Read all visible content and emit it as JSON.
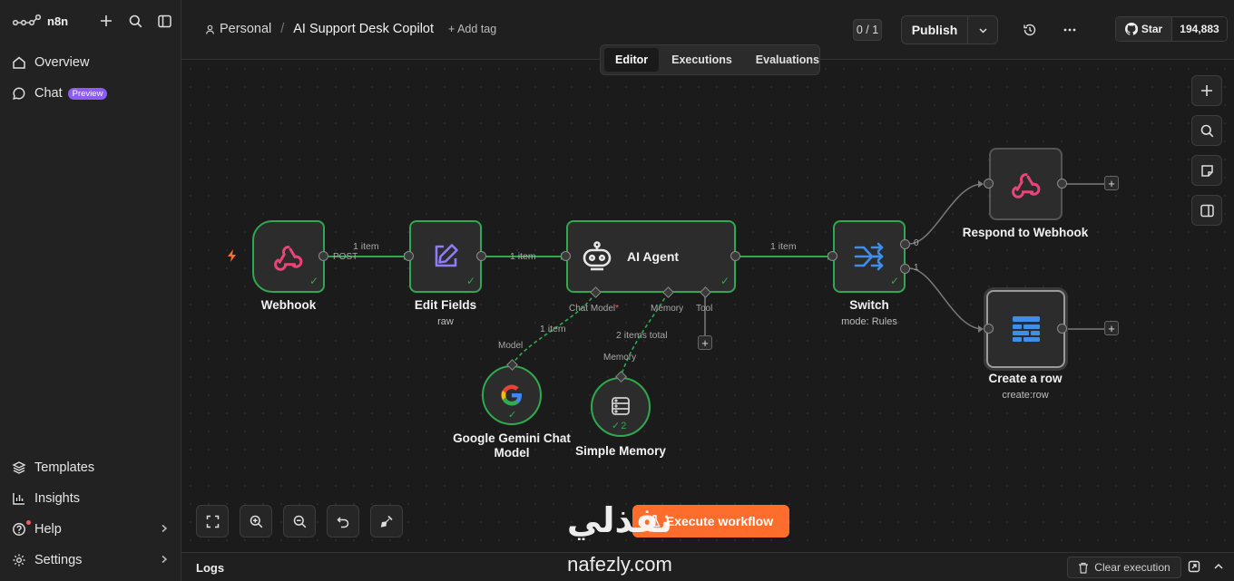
{
  "sidebar": {
    "logo_text": "n8n",
    "items": [
      {
        "label": "Overview"
      },
      {
        "label": "Chat",
        "badge": "Preview"
      }
    ],
    "bottom_items": [
      {
        "label": "Templates"
      },
      {
        "label": "Insights"
      },
      {
        "label": "Help"
      },
      {
        "label": "Settings"
      }
    ]
  },
  "header": {
    "owner": "Personal",
    "separator": "/",
    "workflow_name": "AI Support Desk Copilot",
    "add_tag": "+ Add tag",
    "counter": "0 / 1",
    "publish_label": "Publish",
    "github": {
      "star_label": "Star",
      "count": "194,883"
    }
  },
  "tabs": [
    "Editor",
    "Executions",
    "Evaluations"
  ],
  "active_tab": "Editor",
  "nodes": {
    "webhook": {
      "title": "Webhook"
    },
    "edit_fields": {
      "title": "Edit Fields",
      "subtitle": "raw"
    },
    "ai_agent": {
      "title": "AI Agent"
    },
    "switch": {
      "title": "Switch",
      "subtitle": "mode: Rules"
    },
    "respond": {
      "title": "Respond to Webhook"
    },
    "create_row": {
      "title": "Create a row",
      "subtitle": "create:row"
    },
    "gemini": {
      "title": "Google Gemini Chat Model"
    },
    "memory": {
      "title": "Simple Memory",
      "run_count": "2"
    }
  },
  "edges": {
    "webhook_edit_count": "1 item",
    "webhook_method": "POST",
    "edit_agent_count": "1 item",
    "agent_switch_count": "1 item",
    "gemini_count": "1 item",
    "memory_count": "2 items total"
  },
  "ports": {
    "chat_model": "Chat Model",
    "memory": "Memory",
    "tool": "Tool",
    "model_in": "Model",
    "memory_in": "Memory",
    "switch_out_0": "0",
    "switch_out_1": "1"
  },
  "execute_label": "Execute workflow",
  "logs": {
    "label": "Logs",
    "clear_label": "Clear execution"
  },
  "watermark": {
    "arabic": "نفذلي",
    "latin": "nafezly.com"
  },
  "colors": {
    "success": "#2fa84f",
    "accent": "#ff6d2d",
    "preview": "#8b5cf6"
  }
}
